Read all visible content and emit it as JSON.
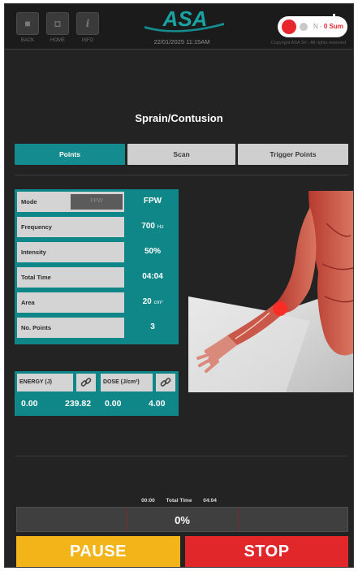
{
  "toolbar": {
    "buttons": [
      {
        "caption": "BACK",
        "icon": "square-icon"
      },
      {
        "caption": "HOME",
        "icon": "home-icon"
      },
      {
        "caption": "INFO",
        "icon": "info-icon"
      }
    ]
  },
  "header": {
    "logo_text": "ASA",
    "datetime": "22/01/2025   11:15AM",
    "status_text": "Ν - ",
    "status_highlight": "0 Sum",
    "copyright": "Copyright ASA Srl - All rights reserved"
  },
  "page": {
    "title": "Sprain/Contusion"
  },
  "tabs": [
    {
      "label": "Points",
      "active": true
    },
    {
      "label": "Scan",
      "active": false
    },
    {
      "label": "Trigger Points",
      "active": false
    }
  ],
  "params": {
    "mode": {
      "label": "Mode",
      "box": "FPW",
      "value": "FPW"
    },
    "frequency": {
      "label": "Frequency",
      "value": "700",
      "unit": "Hz"
    },
    "intensity": {
      "label": "Intensity",
      "value": "50%"
    },
    "total_time": {
      "label": "Total Time",
      "value": "04:04"
    },
    "area": {
      "label": "Area",
      "value": "20",
      "unit": "cm²"
    },
    "no_points": {
      "label": "No. Points",
      "value": "3"
    }
  },
  "energy": {
    "label": "ENERGY (J)",
    "current": "0.00",
    "total": "239.82"
  },
  "dose": {
    "label": "DOSE (J/cm²)",
    "current": "0.00",
    "total": "4.00"
  },
  "progress": {
    "elapsed": "00:00",
    "total_label": "Total Time",
    "total": "04:04",
    "percent_text": "0%",
    "fraction": 0
  },
  "actions": {
    "pause": "PAUSE",
    "stop": "STOP"
  },
  "colors": {
    "teal": "#148b8e",
    "pause": "#f2b418",
    "stop": "#e2272b",
    "background": "#232323"
  }
}
